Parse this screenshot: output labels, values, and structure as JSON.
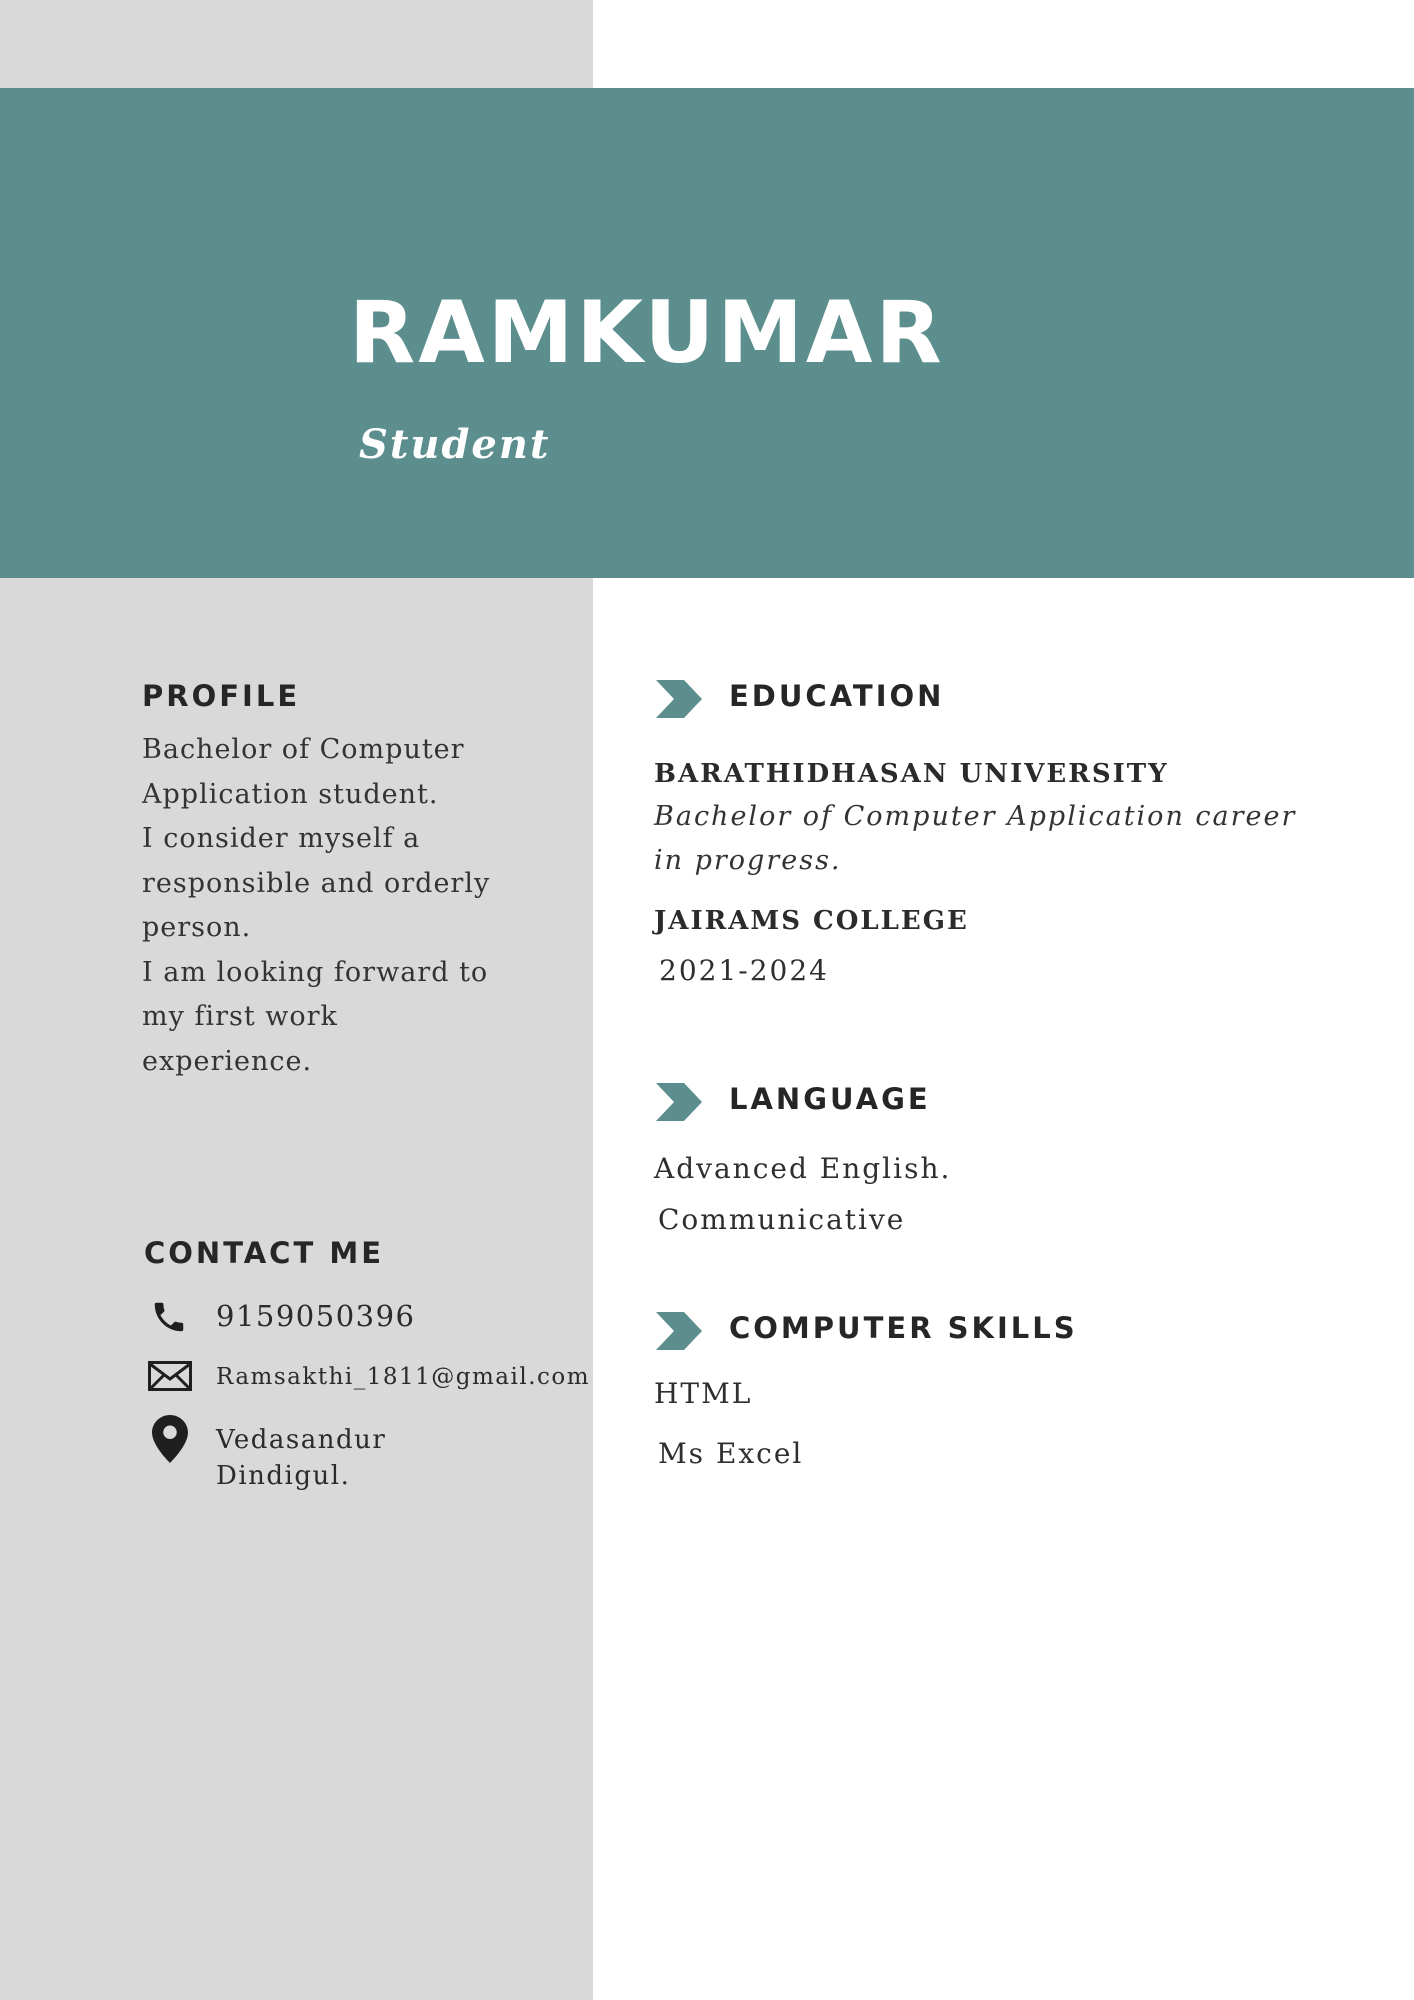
{
  "header": {
    "name": "RAMKUMAR",
    "role": "Student"
  },
  "colors": {
    "accent": "#5c8e8e",
    "sidebar": "#d9d9d9",
    "text": "#262626"
  },
  "profile": {
    "heading": "PROFILE",
    "lines": [
      "Bachelor of Computer",
      "Application student.",
      "I consider myself a",
      "responsible and orderly",
      "person.",
      "I am looking forward to",
      "my first work",
      "experience."
    ]
  },
  "contact": {
    "heading": "CONTACT ME",
    "phone": "9159050396",
    "email": "Ramsakthi_1811@gmail.com",
    "address_line1": "Vedasandur",
    "address_line2": "Dindigul.",
    "icons": [
      "phone-icon",
      "mail-icon",
      "location-pin-icon"
    ]
  },
  "education": {
    "heading": "EDUCATION",
    "university": "BARATHIDHASAN UNIVERSITY",
    "degree_line1": "Bachelor of Computer Application career",
    "degree_line2": "in progress.",
    "college": "JAIRAMS COLLEGE",
    "years": "2021-2024"
  },
  "language": {
    "heading": "LANGUAGE",
    "items": [
      "Advanced English.",
      "Communicative"
    ]
  },
  "skills": {
    "heading": "COMPUTER SKILLS",
    "items": [
      "HTML",
      "Ms Excel"
    ]
  }
}
